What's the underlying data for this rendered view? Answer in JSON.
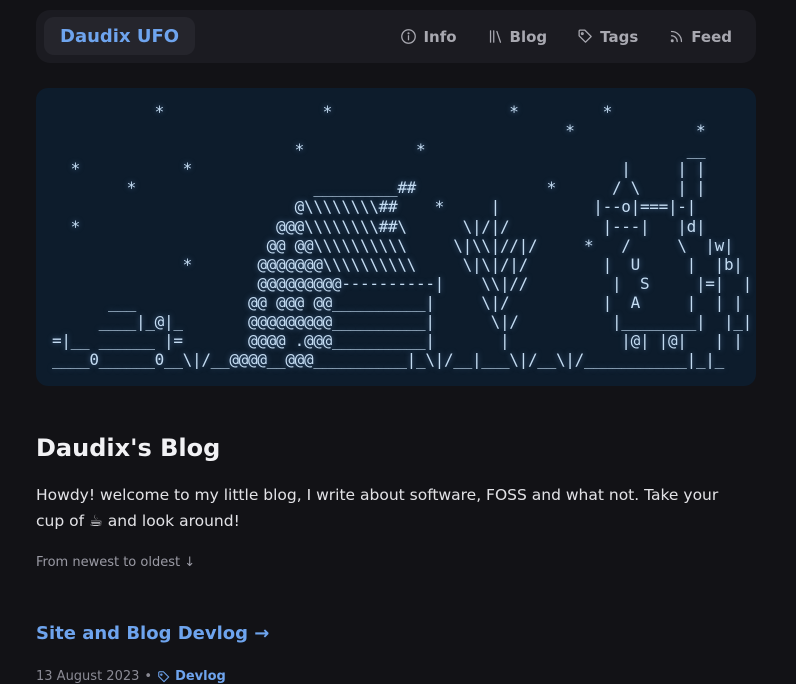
{
  "header": {
    "brand": "Daudix UFO",
    "nav": [
      {
        "label": "Info",
        "icon": "info-icon"
      },
      {
        "label": "Blog",
        "icon": "library-icon"
      },
      {
        "label": "Tags",
        "icon": "tag-icon"
      },
      {
        "label": "Feed",
        "icon": "rss-icon"
      }
    ]
  },
  "banner": {
    "ascii": "           *                 *                   *         *\n                                                       *             *\n                          *            *                            __\n  *           *                                              |     | |\n        *                   _________##              *      / \\    | |\n                          @\\\\\\\\\\\\\\\\##    *     |          |--o|===|-|\n  *                     @@@\\\\\\\\\\\\\\\\##\\      \\|/|/          |---|   |d|\n                       @@ @@\\\\\\\\\\\\\\\\\\\\     \\|\\\\|//|/     *   /     \\  |w|\n              *       @@@@@@@\\\\\\\\\\\\\\\\\\\\     \\|\\|/|/        |  U     |  |b|\n                      @@@@@@@@@----------|    \\\\|//         |  S     |=|  |\n      ___            @@ @@@ @@__________|     \\|/          |  A     |  | |\n     ____|_@|_       @@@@@@@@@__________|      \\|/          |________|  |_|\n=|__ ______ |=       @@@@ .@@@__________|       |            |@| |@|   | |\n____0______0__\\|/__@@@@__@@@__________|_\\|/__|___\\|/__\\|/___________|_|_",
    "colors": {
      "background": "#0d1c2c",
      "text": "#c4dcf2"
    }
  },
  "main": {
    "title": "Daudix's Blog",
    "intro": "Howdy! welcome to my little blog, I write about software, FOSS and what not. Take your cup of ☕ and look around!",
    "order_note": "From newest to oldest ↓",
    "posts": [
      {
        "title": "Site and Blog Devlog →",
        "date": "13 August 2023",
        "separator": "•",
        "tag": "Devlog"
      }
    ]
  },
  "colors": {
    "accent": "#6ea4ee",
    "background": "#121216",
    "surface": "#1b1b21"
  }
}
